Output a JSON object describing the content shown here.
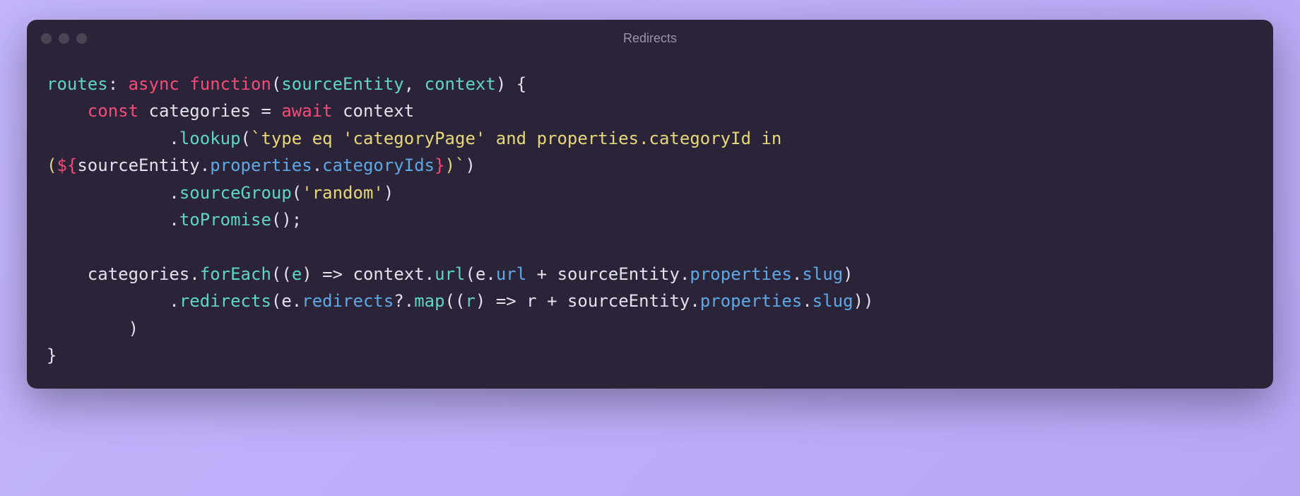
{
  "window": {
    "title": "Redirects"
  },
  "code": {
    "line1": {
      "routes": "routes",
      "colon": ": ",
      "async": "async",
      "sp": " ",
      "function": "function",
      "paren_o": "(",
      "p1": "sourceEntity",
      "comma": ", ",
      "p2": "context",
      "paren_c": ") {"
    },
    "line2": {
      "indent": "    ",
      "const": "const",
      "sp": " ",
      "var": "categories",
      "eq": " = ",
      "await": "await",
      "sp2": " ",
      "ctx": "context"
    },
    "line3": {
      "indent": "            ",
      "dot": ".",
      "method": "lookup",
      "paren_o": "(",
      "tick": "`",
      "str1": "type eq 'categoryPage' and properties.categoryId in "
    },
    "line4": {
      "paren_o": "(",
      "interp_o": "${",
      "se": "sourceEntity",
      "dot1": ".",
      "props": "properties",
      "dot2": ".",
      "cids": "categoryIds",
      "interp_c": "}",
      "paren_c": ")",
      "tick": "`",
      "close": ")"
    },
    "line5": {
      "indent": "            ",
      "dot": ".",
      "method": "sourceGroup",
      "paren_o": "(",
      "str": "'random'",
      "paren_c": ")"
    },
    "line6": {
      "indent": "            ",
      "dot": ".",
      "method": "toPromise",
      "parens": "();"
    },
    "line7": {
      "blank": ""
    },
    "line8": {
      "indent": "    ",
      "cats": "categories",
      "dot": ".",
      "foreach": "forEach",
      "args_o": "((",
      "e": "e",
      "arrow": ") => ",
      "ctx": "context",
      "dot2": ".",
      "url": "url",
      "paren_o": "(",
      "e2": "e",
      "dot3": ".",
      "urlprop": "url",
      "plus": " + ",
      "se": "sourceEntity",
      "dot4": ".",
      "props": "properties",
      "dot5": ".",
      "slug": "slug",
      "paren_c": ")"
    },
    "line9": {
      "indent": "            ",
      "dot": ".",
      "redirects": "redirects",
      "paren_o": "(",
      "e": "e",
      "dot2": ".",
      "redprop": "redirects",
      "q": "?",
      "dot3": ".",
      "map": "map",
      "args_o": "((",
      "r": "r",
      "arrow": ") => ",
      "r2": "r",
      "plus": " + ",
      "se": "sourceEntity",
      "dot4": ".",
      "props": "properties",
      "dot5": ".",
      "slug": "slug",
      "close": "))"
    },
    "line10": {
      "indent": "        ",
      "paren": ")"
    },
    "line11": {
      "brace": "}"
    }
  }
}
